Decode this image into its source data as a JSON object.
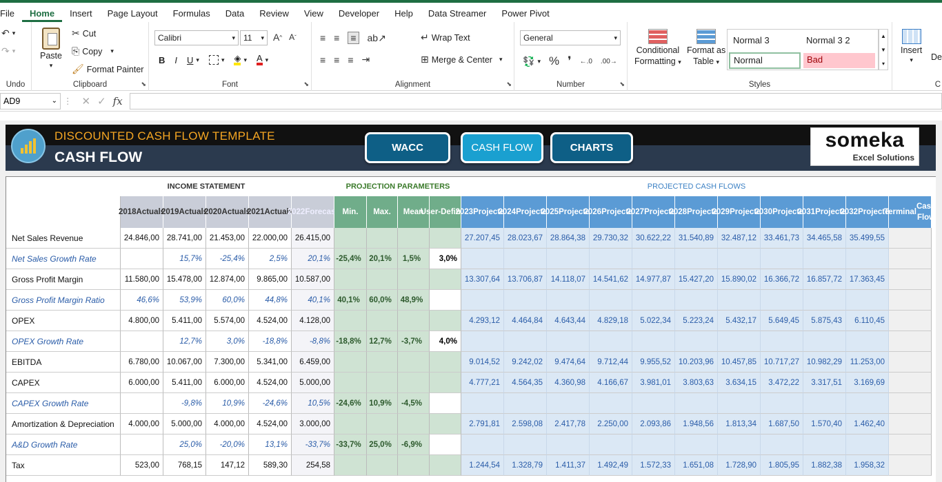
{
  "menu": [
    "File",
    "Home",
    "Insert",
    "Page Layout",
    "Formulas",
    "Data",
    "Review",
    "View",
    "Developer",
    "Help",
    "Data Streamer",
    "Power Pivot"
  ],
  "ribbon": {
    "undo_label": "Undo",
    "clipboard": {
      "paste": "Paste",
      "cut": "Cut",
      "copy": "Copy",
      "format_painter": "Format Painter",
      "label": "Clipboard"
    },
    "font": {
      "name": "Calibri",
      "size": "11",
      "label": "Font"
    },
    "alignment": {
      "wrap": "Wrap Text",
      "merge": "Merge & Center",
      "label": "Alignment"
    },
    "number": {
      "format": "General",
      "label": "Number"
    },
    "styles": {
      "conditional": "Conditional",
      "formatting": "Formatting",
      "format_as": "Format as",
      "table": "Table",
      "normal3": "Normal 3",
      "normal32": "Normal 3 2",
      "normal": "Normal",
      "bad": "Bad",
      "label": "Styles"
    },
    "cells": {
      "insert": "Insert",
      "delete": "De",
      "label": "C"
    }
  },
  "formula_bar": {
    "name_box": "AD9",
    "fx": "fx",
    "value": ""
  },
  "banner": {
    "title1": "DISCOUNTED CASH FLOW TEMPLATE",
    "title2": "CASH FLOW",
    "buttons": [
      "WACC",
      "CASH FLOW",
      "CHARTS"
    ],
    "brand": "someka",
    "brand_sub": "Excel Solutions"
  },
  "table": {
    "sections": {
      "income": "INCOME STATEMENT",
      "projection": "PROJECTION PARAMETERS",
      "projected": "PROJECTED CASH FLOWS"
    },
    "headers": [
      [
        "2018",
        "Actuals"
      ],
      [
        "2019",
        "Actuals"
      ],
      [
        "2020",
        "Actuals"
      ],
      [
        "2021",
        "Actuals"
      ],
      [
        "2022",
        "Forecast"
      ],
      [
        "Min.",
        ""
      ],
      [
        "Max.",
        ""
      ],
      [
        "Mean",
        ""
      ],
      [
        "User-",
        "Defined"
      ],
      [
        "2023",
        "Projected"
      ],
      [
        "2024",
        "Projected"
      ],
      [
        "2025",
        "Projected"
      ],
      [
        "2026",
        "Projected"
      ],
      [
        "2027",
        "Projected"
      ],
      [
        "2028",
        "Projected"
      ],
      [
        "2029",
        "Projected"
      ],
      [
        "2030",
        "Projected"
      ],
      [
        "2031",
        "Projected"
      ],
      [
        "2032",
        "Projected"
      ],
      [
        "Terminal",
        "Cash Flow"
      ]
    ],
    "rows": [
      {
        "label": "Net Sales Revenue",
        "style": "main",
        "actuals": [
          "24.846,00",
          "28.741,00",
          "21.453,00",
          "22.000,00",
          "26.415,00"
        ],
        "params": [
          "",
          "",
          "",
          ""
        ],
        "proj": [
          "27.207,45",
          "28.023,67",
          "28.864,38",
          "29.730,32",
          "30.622,22",
          "31.540,89",
          "32.487,12",
          "33.461,73",
          "34.465,58",
          "35.499,55"
        ]
      },
      {
        "label": "Net Sales Growth Rate",
        "style": "ratio",
        "actuals": [
          "",
          "15,7%",
          "-25,4%",
          "2,5%",
          "20,1%"
        ],
        "params": [
          "-25,4%",
          "20,1%",
          "1,5%",
          "3,0%"
        ],
        "proj": [
          "",
          "",
          "",
          "",
          "",
          "",
          "",
          "",
          "",
          ""
        ]
      },
      {
        "label": "Gross Profit Margin",
        "style": "main",
        "actuals": [
          "11.580,00",
          "15.478,00",
          "12.874,00",
          "9.865,00",
          "10.587,00"
        ],
        "params": [
          "",
          "",
          "",
          ""
        ],
        "proj": [
          "13.307,64",
          "13.706,87",
          "14.118,07",
          "14.541,62",
          "14.977,87",
          "15.427,20",
          "15.890,02",
          "16.366,72",
          "16.857,72",
          "17.363,45"
        ]
      },
      {
        "label": "Gross Profit Margin Ratio",
        "style": "ratio",
        "actuals": [
          "46,6%",
          "53,9%",
          "60,0%",
          "44,8%",
          "40,1%"
        ],
        "params": [
          "40,1%",
          "60,0%",
          "48,9%",
          ""
        ],
        "proj": [
          "",
          "",
          "",
          "",
          "",
          "",
          "",
          "",
          "",
          ""
        ]
      },
      {
        "label": "OPEX",
        "style": "main",
        "actuals": [
          "4.800,00",
          "5.411,00",
          "5.574,00",
          "4.524,00",
          "4.128,00"
        ],
        "params": [
          "",
          "",
          "",
          ""
        ],
        "proj": [
          "4.293,12",
          "4.464,84",
          "4.643,44",
          "4.829,18",
          "5.022,34",
          "5.223,24",
          "5.432,17",
          "5.649,45",
          "5.875,43",
          "6.110,45"
        ]
      },
      {
        "label": "OPEX Growth Rate",
        "style": "ratio",
        "actuals": [
          "",
          "12,7%",
          "3,0%",
          "-18,8%",
          "-8,8%"
        ],
        "params": [
          "-18,8%",
          "12,7%",
          "-3,7%",
          "4,0%"
        ],
        "proj": [
          "",
          "",
          "",
          "",
          "",
          "",
          "",
          "",
          "",
          ""
        ]
      },
      {
        "label": "EBITDA",
        "style": "main",
        "actuals": [
          "6.780,00",
          "10.067,00",
          "7.300,00",
          "5.341,00",
          "6.459,00"
        ],
        "params": [
          "",
          "",
          "",
          ""
        ],
        "proj": [
          "9.014,52",
          "9.242,02",
          "9.474,64",
          "9.712,44",
          "9.955,52",
          "10.203,96",
          "10.457,85",
          "10.717,27",
          "10.982,29",
          "11.253,00"
        ]
      },
      {
        "label": "CAPEX",
        "style": "main",
        "actuals": [
          "6.000,00",
          "5.411,00",
          "6.000,00",
          "4.524,00",
          "5.000,00"
        ],
        "params": [
          "",
          "",
          "",
          ""
        ],
        "proj": [
          "4.777,21",
          "4.564,35",
          "4.360,98",
          "4.166,67",
          "3.981,01",
          "3.803,63",
          "3.634,15",
          "3.472,22",
          "3.317,51",
          "3.169,69"
        ]
      },
      {
        "label": "CAPEX Growth Rate",
        "style": "ratio",
        "actuals": [
          "",
          "-9,8%",
          "10,9%",
          "-24,6%",
          "10,5%"
        ],
        "params": [
          "-24,6%",
          "10,9%",
          "-4,5%",
          ""
        ],
        "proj": [
          "",
          "",
          "",
          "",
          "",
          "",
          "",
          "",
          "",
          ""
        ]
      },
      {
        "label": "Amortization & Depreciation",
        "style": "main",
        "actuals": [
          "4.000,00",
          "5.000,00",
          "4.000,00",
          "4.524,00",
          "3.000,00"
        ],
        "params": [
          "",
          "",
          "",
          ""
        ],
        "proj": [
          "2.791,81",
          "2.598,08",
          "2.417,78",
          "2.250,00",
          "2.093,86",
          "1.948,56",
          "1.813,34",
          "1.687,50",
          "1.570,40",
          "1.462,40"
        ]
      },
      {
        "label": "A&D Growth Rate",
        "style": "ratio",
        "actuals": [
          "",
          "25,0%",
          "-20,0%",
          "13,1%",
          "-33,7%"
        ],
        "params": [
          "-33,7%",
          "25,0%",
          "-6,9%",
          ""
        ],
        "proj": [
          "",
          "",
          "",
          "",
          "",
          "",
          "",
          "",
          "",
          ""
        ]
      },
      {
        "label": "Tax",
        "style": "main",
        "actuals": [
          "523,00",
          "768,15",
          "147,12",
          "589,30",
          "254,58"
        ],
        "params": [
          "",
          "",
          "",
          ""
        ],
        "proj": [
          "1.244,54",
          "1.328,79",
          "1.411,37",
          "1.492,49",
          "1.572,33",
          "1.651,08",
          "1.728,90",
          "1.805,95",
          "1.882,38",
          "1.958,32"
        ]
      }
    ]
  }
}
